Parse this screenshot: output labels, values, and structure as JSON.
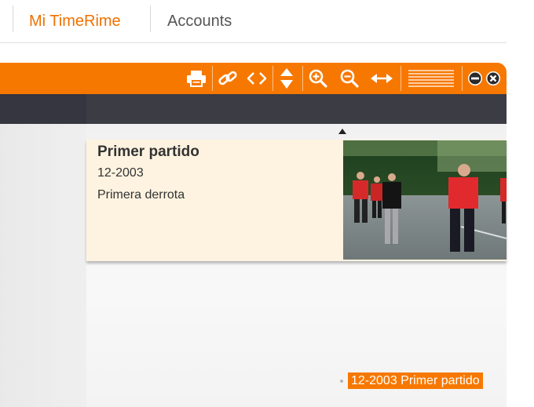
{
  "nav": {
    "items": [
      {
        "label": "Mi TimeRime",
        "active": true
      },
      {
        "label": "Accounts",
        "active": false
      }
    ]
  },
  "toolbar": {
    "buttons": [
      {
        "name": "print-icon"
      },
      {
        "name": "link-icon"
      },
      {
        "name": "embed-code-icon"
      },
      {
        "name": "vertical-resize-icon"
      },
      {
        "name": "zoom-in-icon"
      },
      {
        "name": "zoom-out-icon"
      },
      {
        "name": "horizontal-resize-icon"
      },
      {
        "name": "layout-lines-icon"
      },
      {
        "name": "minimize-icon"
      },
      {
        "name": "close-icon"
      }
    ]
  },
  "colors": {
    "accent": "#f77800",
    "dark_band": "#3b3c44",
    "card_background": "#fdf3e0"
  },
  "event": {
    "title": "Primer partido",
    "date": "12-2003",
    "description": "Primera derrota"
  },
  "timeline_marker": {
    "label": "12-2003 Primer partido"
  }
}
